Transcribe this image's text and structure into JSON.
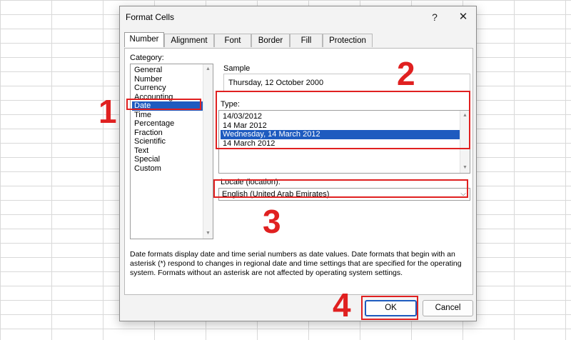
{
  "dialog": {
    "title": "Format Cells",
    "help_label": "?",
    "close_label": "✕"
  },
  "tabs": [
    {
      "label": "Number",
      "active": true
    },
    {
      "label": "Alignment"
    },
    {
      "label": "Font"
    },
    {
      "label": "Border"
    },
    {
      "label": "Fill"
    },
    {
      "label": "Protection"
    }
  ],
  "category": {
    "label": "Category:",
    "items": [
      "General",
      "Number",
      "Currency",
      "Accounting",
      "Date",
      "Time",
      "Percentage",
      "Fraction",
      "Scientific",
      "Text",
      "Special",
      "Custom"
    ],
    "selected": "Date"
  },
  "sample": {
    "label": "Sample",
    "value": "Thursday, 12 October 2000"
  },
  "type": {
    "label": "Type:",
    "items": [
      "14/03/2012",
      "14 Mar 2012",
      "Wednesday, 14 March 2012",
      "14 March 2012"
    ],
    "selected": "Wednesday, 14 March 2012"
  },
  "locale": {
    "label": "Locale (location):",
    "value": "English (United Arab Emirates)"
  },
  "description": "Date formats display date and time serial numbers as date values.  Date formats that begin with an asterisk (*) respond to changes in regional date and time settings that are specified for the operating system. Formats without an asterisk are not affected by operating system settings.",
  "buttons": {
    "ok": "OK",
    "cancel": "Cancel"
  },
  "annotations": {
    "step1": "1",
    "step2": "2",
    "step3": "3",
    "step4": "4",
    "color": "#e02020"
  }
}
